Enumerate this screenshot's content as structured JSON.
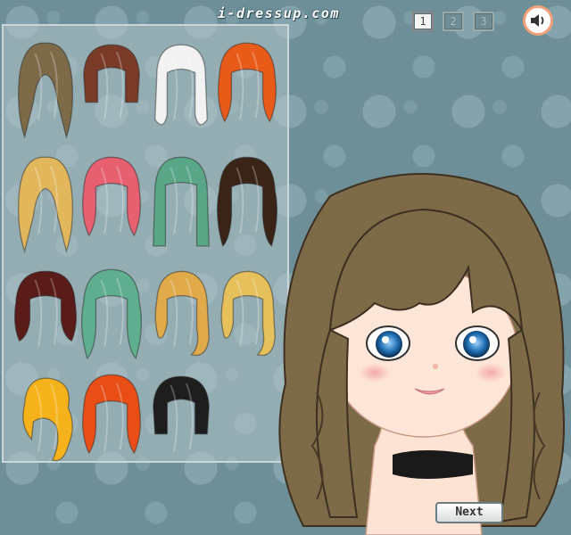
{
  "header": {
    "site_logo": "i-dressup.com"
  },
  "pager": {
    "pages": [
      "1",
      "2",
      "3"
    ],
    "active_page": "1"
  },
  "sound": {
    "icon": "speaker-icon",
    "muted": false
  },
  "hair_palette": {
    "rows": [
      [
        {
          "style": "long-wavy",
          "color": "#7d6a48"
        },
        {
          "style": "bob-bangs",
          "color": "#7a3a28"
        },
        {
          "style": "curly-buns",
          "color": "#f2f2f2"
        },
        {
          "style": "wavy-medium",
          "color": "#e85a18"
        }
      ],
      [
        {
          "style": "long-wavy",
          "color": "#e2b75c"
        },
        {
          "style": "wavy-medium",
          "color": "#e66070"
        },
        {
          "style": "straight-long",
          "color": "#5aa787"
        },
        {
          "style": "curly-long",
          "color": "#3a2418"
        }
      ],
      [
        {
          "style": "curly-medium",
          "color": "#5a1c18"
        },
        {
          "style": "curly-long",
          "color": "#5fae90"
        },
        {
          "style": "side-wave",
          "color": "#e0a94a"
        },
        {
          "style": "side-wave",
          "color": "#e6c05a"
        }
      ],
      [
        {
          "style": "ponytail",
          "color": "#f5b21a"
        },
        {
          "style": "wavy-medium",
          "color": "#e84e16"
        },
        {
          "style": "bob-bangs",
          "color": "#1e1e1e"
        }
      ]
    ]
  },
  "doll": {
    "hair_color": "#7d6a48",
    "eye_color": "#1f6fb2",
    "top_color": "#1a1a1a"
  },
  "navigation": {
    "next_label": "Next"
  }
}
